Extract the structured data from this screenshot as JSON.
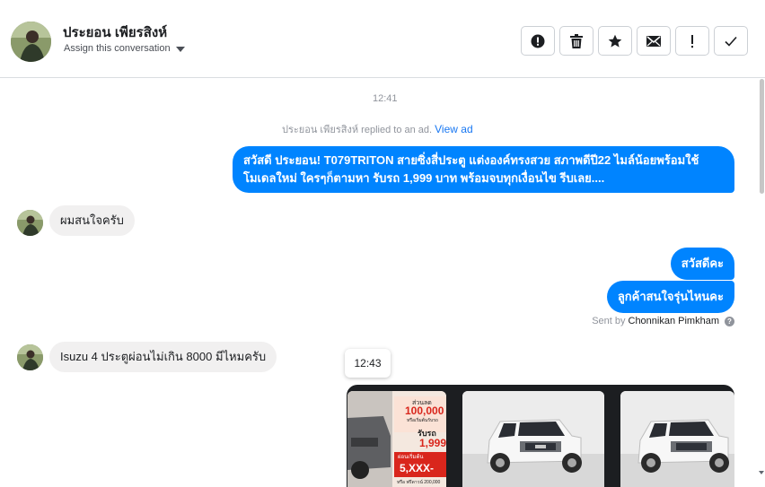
{
  "header": {
    "contact_name": "ประยอน เพียรสิงห์",
    "assign_label": "Assign this conversation",
    "actions": [
      {
        "name": "spam-button",
        "icon": "alert-circle-icon"
      },
      {
        "name": "delete-button",
        "icon": "trash-icon"
      },
      {
        "name": "star-button",
        "icon": "star-icon"
      },
      {
        "name": "mark-unread-button",
        "icon": "envelope-icon"
      },
      {
        "name": "follow-up-button",
        "icon": "exclamation-icon"
      },
      {
        "name": "mark-done-button",
        "icon": "checkmark-icon"
      }
    ]
  },
  "thread": {
    "time_1": "12:41",
    "reply_note": "ประยอน เพียรสิงห์ replied to an ad.",
    "view_ad_link": "View ad",
    "message_out_1": "สวัสดี ประยอน! T079TRITON สายซิ่งสี่ประตู แต่งองค์ทรงสวย สภาพดีปี22 ไมล์น้อยพร้อมใช้ โมเดลใหม่ ใครๆก็ตามหา รับรถ 1,999 บาท พร้อมจบทุกเงื่อนไข รีบเลย....",
    "message_in_1": "ผมสนใจครับ",
    "message_out_2": "สวัสดีคะ",
    "message_out_3": "ลูกค้าสนใจรุ่นไหนคะ",
    "sent_by_prefix": "Sent by",
    "sent_by_agent": "Chonnikan Pimkham",
    "message_in_2": "Isuzu 4 ประตูผ่อนไม่เกิน 8000 มีไหมครับ",
    "tooltip_time": "12:43",
    "carousel": {
      "promo": {
        "line_1": "ส่วนลด",
        "amount": "100,000",
        "line_2": "หรือเริ่มต้นรับรถ",
        "receive_label": "รับรถ",
        "receive_price": "1,999",
        "installment_label": "ผ่อนเริ่มต้น",
        "installment": "5,XXX-",
        "footnote": "หรือ ฟรีดาวน์ 200,000"
      }
    }
  },
  "colors": {
    "accent": "#0084ff",
    "incoming_bubble": "#f1f0f0",
    "link": "#1877f2"
  }
}
